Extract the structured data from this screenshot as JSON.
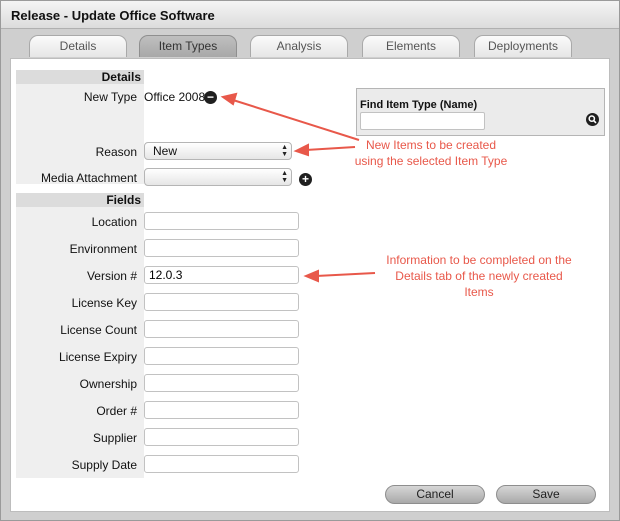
{
  "window": {
    "title": "Release - Update Office Software"
  },
  "tabs": [
    {
      "label": "Details"
    },
    {
      "label": "Item Types"
    },
    {
      "label": "Analysis"
    },
    {
      "label": "Elements"
    },
    {
      "label": "Deployments"
    }
  ],
  "active_tab": "Item Types",
  "details": {
    "header": "Details",
    "new_type_label": "New Type",
    "new_type_value": "Office 2008",
    "reason_label": "Reason",
    "reason_value": "New",
    "media_label": "Media Attachment",
    "media_value": ""
  },
  "find": {
    "label": "Find Item Type (Name)",
    "value": ""
  },
  "fields": {
    "header": "Fields",
    "items": [
      {
        "label": "Location",
        "value": ""
      },
      {
        "label": "Environment",
        "value": ""
      },
      {
        "label": "Version #",
        "value": "12.0.3"
      },
      {
        "label": "License Key",
        "value": ""
      },
      {
        "label": "License Count",
        "value": ""
      },
      {
        "label": "License Expiry",
        "value": ""
      },
      {
        "label": "Ownership",
        "value": ""
      },
      {
        "label": "Order #",
        "value": ""
      },
      {
        "label": "Supplier",
        "value": ""
      },
      {
        "label": "Supply Date",
        "value": ""
      }
    ]
  },
  "annotations": {
    "new_items": "New Items to be created using the selected Item Type",
    "information": "Information to be completed on the Details tab of the newly created Items",
    "color": "#e8584a"
  },
  "buttons": {
    "cancel": "Cancel",
    "save": "Save"
  }
}
